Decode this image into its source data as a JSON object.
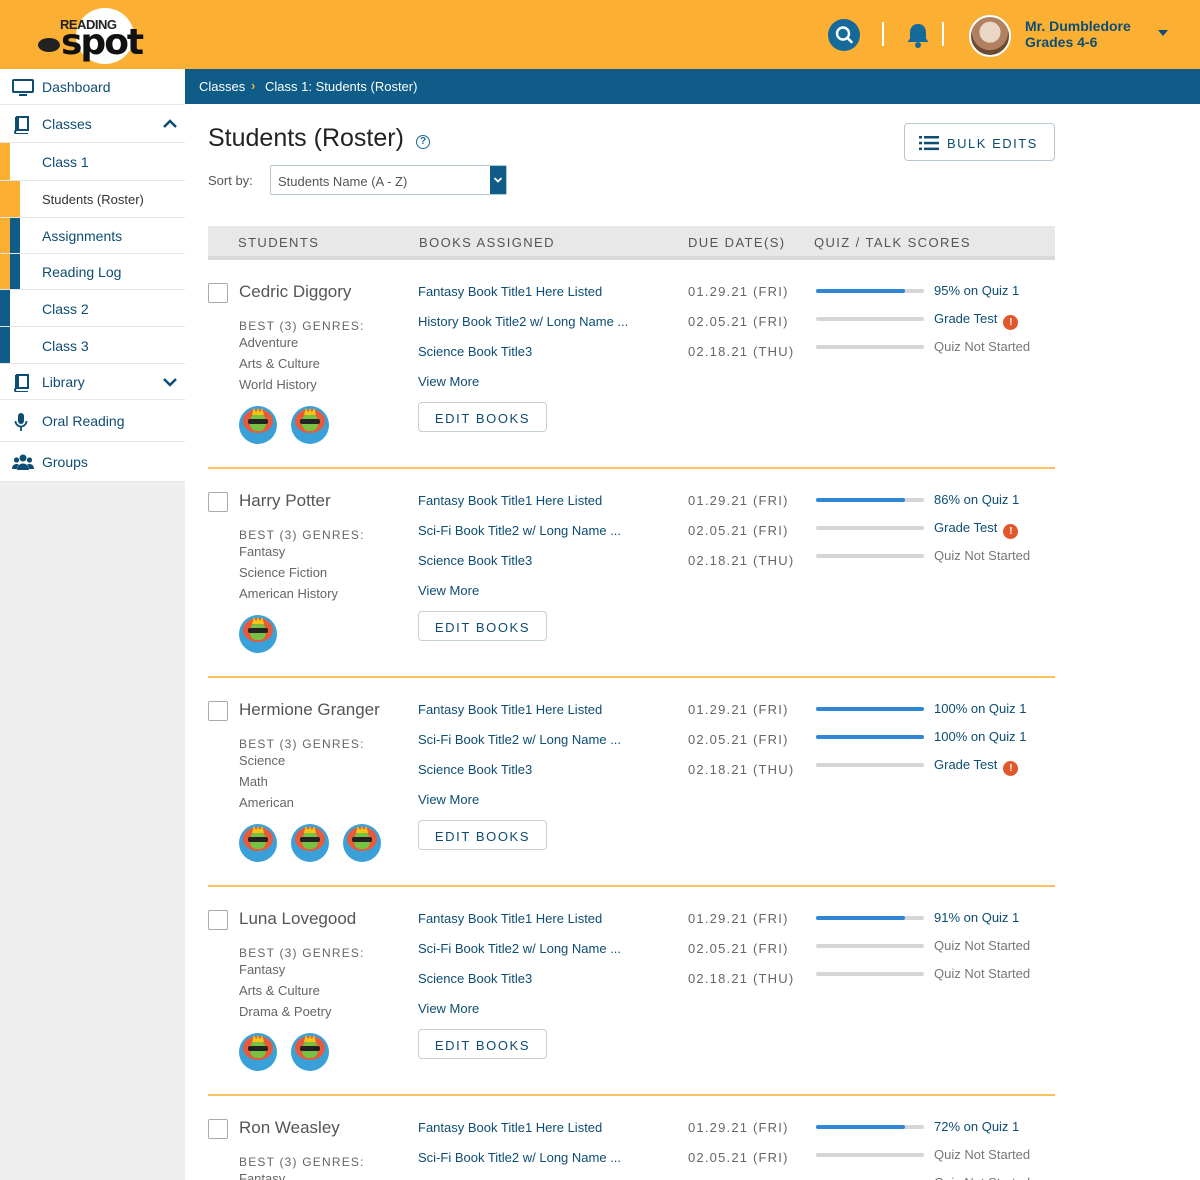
{
  "header": {
    "logo_top": "READING",
    "logo_main": "spot",
    "user_name": "Mr. Dumbledore",
    "user_grades": "Grades 4-6"
  },
  "colors": {
    "brand_yellow": "#fbb034",
    "brand_blue": "#0e5c87",
    "text_blue": "#0d4c73",
    "progress_blue": "#2f86d4",
    "alert_red": "#e2572b"
  },
  "sidebar": {
    "dashboard": "Dashboard",
    "classes": "Classes",
    "class1": "Class 1",
    "students_roster": "Students (Roster)",
    "assignments": "Assignments",
    "reading_log": "Reading Log",
    "class2": "Class 2",
    "class3": "Class 3",
    "library": "Library",
    "oral_reading": "Oral Reading",
    "groups": "Groups"
  },
  "breadcrumb": {
    "root": "Classes",
    "sep": "›",
    "current": "Class 1: Students (Roster)"
  },
  "page": {
    "title": "Students (Roster)",
    "help": "?",
    "sort_label": "Sort by:",
    "sort_value": "Students Name (A - Z)",
    "bulk_edits": "BULK EDITS"
  },
  "table": {
    "col_students": "STUDENTS",
    "col_books": "BOOKS ASSIGNED",
    "col_due": "DUE DATE(S)",
    "col_scores": "QUIZ / TALK SCORES",
    "genres_heading": "BEST (3) GENRES:",
    "view_more": "View More",
    "edit_books": "EDIT BOOKS"
  },
  "students": [
    {
      "name": "Cedric Diggory",
      "genres": [
        "Adventure",
        "Arts & Culture",
        "World History"
      ],
      "badges": 2,
      "books": [
        "Fantasy Book Title1 Here Listed",
        "History Book Title2 w/ Long Name ...",
        "Science Book Title3"
      ],
      "due": [
        "01.29.21  (FRI)",
        "02.05.21  (FRI)",
        "02.18.21  (THU)"
      ],
      "progress": [
        0.82,
        0,
        0
      ],
      "scores": [
        {
          "text": "95% on Quiz 1",
          "style": "link",
          "alert": false
        },
        {
          "text": "Grade Test",
          "style": "link",
          "alert": true
        },
        {
          "text": "Quiz Not Started",
          "style": "muted",
          "alert": false
        }
      ]
    },
    {
      "name": "Harry Potter",
      "genres": [
        "Fantasy",
        "Science Fiction",
        "American History"
      ],
      "badges": 1,
      "books": [
        "Fantasy Book Title1 Here Listed",
        "Sci-Fi Book Title2 w/ Long Name ...",
        "Science Book Title3"
      ],
      "due": [
        "01.29.21  (FRI)",
        "02.05.21  (FRI)",
        "02.18.21  (THU)"
      ],
      "progress": [
        0.82,
        0,
        0
      ],
      "scores": [
        {
          "text": "86% on Quiz 1",
          "style": "link",
          "alert": false
        },
        {
          "text": "Grade Test",
          "style": "link",
          "alert": true
        },
        {
          "text": "Quiz Not Started",
          "style": "muted",
          "alert": false
        }
      ]
    },
    {
      "name": "Hermione Granger",
      "genres": [
        "Science",
        "Math",
        "American"
      ],
      "badges": 3,
      "books": [
        "Fantasy Book Title1 Here Listed",
        "Sci-Fi Book Title2 w/ Long Name ...",
        "Science Book Title3"
      ],
      "due": [
        "01.29.21  (FRI)",
        "02.05.21  (FRI)",
        "02.18.21  (THU)"
      ],
      "progress": [
        1,
        1,
        0
      ],
      "scores": [
        {
          "text": "100% on Quiz 1",
          "style": "link",
          "alert": false
        },
        {
          "text": "100% on Quiz 1",
          "style": "link",
          "alert": false
        },
        {
          "text": "Grade Test",
          "style": "link",
          "alert": true
        }
      ]
    },
    {
      "name": "Luna Lovegood",
      "genres": [
        "Fantasy",
        "Arts & Culture",
        "Drama & Poetry"
      ],
      "badges": 2,
      "books": [
        "Fantasy Book Title1 Here Listed",
        "Sci-Fi Book Title2 w/ Long Name ...",
        "Science Book Title3"
      ],
      "due": [
        "01.29.21  (FRI)",
        "02.05.21  (FRI)",
        "02.18.21  (THU)"
      ],
      "progress": [
        0.82,
        0,
        0
      ],
      "scores": [
        {
          "text": "91% on Quiz 1",
          "style": "link",
          "alert": false
        },
        {
          "text": "Quiz Not Started",
          "style": "muted",
          "alert": false
        },
        {
          "text": "Quiz Not Started",
          "style": "muted",
          "alert": false
        }
      ]
    },
    {
      "name": "Ron Weasley",
      "genres": [
        "Fantasy"
      ],
      "badges": 0,
      "books": [
        "Fantasy Book Title1 Here Listed",
        "Sci-Fi Book Title2 w/ Long Name ..."
      ],
      "due": [
        "01.29.21  (FRI)",
        "02.05.21  (FRI)"
      ],
      "progress": [
        0.82,
        0,
        0
      ],
      "scores": [
        {
          "text": "72% on Quiz 1",
          "style": "link",
          "alert": false
        },
        {
          "text": "Quiz Not Started",
          "style": "muted",
          "alert": false
        },
        {
          "text": "Quiz Not Started",
          "style": "muted",
          "alert": false
        }
      ]
    }
  ]
}
